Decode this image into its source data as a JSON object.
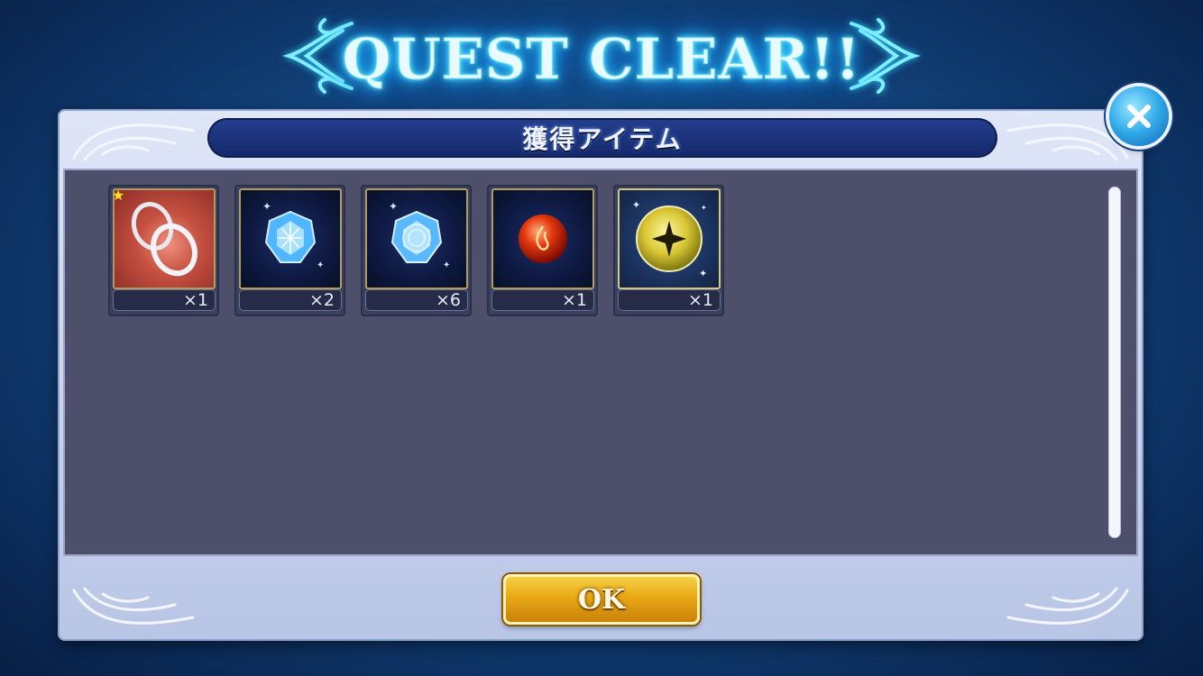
{
  "title": "QUEST CLEAR!!",
  "panel": {
    "header": "獲得アイテム"
  },
  "items": [
    {
      "icon": "silver-rings-icon",
      "count": "×1",
      "rare": true
    },
    {
      "icon": "blue-crystal-icon",
      "count": "×2"
    },
    {
      "icon": "blue-crystal-icon",
      "count": "×6"
    },
    {
      "icon": "red-fire-orb-icon",
      "count": "×1"
    },
    {
      "icon": "gold-star-orb-icon",
      "count": "×1"
    }
  ],
  "ok_button": "OK",
  "close_icon": "close-icon",
  "colors": {
    "background": "#12457f",
    "header_bar": "#1b3278",
    "content": "#4e4f6b",
    "ok_gold": "#e9a915",
    "title_glow": "#34d6ff"
  }
}
